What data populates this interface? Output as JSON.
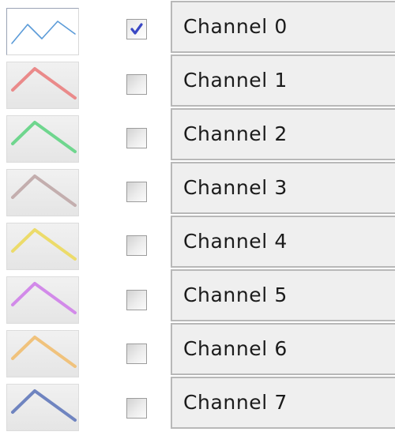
{
  "channels": [
    {
      "label": "Channel 0",
      "checked": true,
      "color": "#5b9bd8",
      "icon": "wave-icon"
    },
    {
      "label": "Channel 1",
      "checked": false,
      "color": "#ea8a8a",
      "icon": "peak-icon"
    },
    {
      "label": "Channel 2",
      "checked": false,
      "color": "#6fd68e",
      "icon": "peak-icon"
    },
    {
      "label": "Channel 3",
      "checked": false,
      "color": "#c3aeae",
      "icon": "peak-icon"
    },
    {
      "label": "Channel 4",
      "checked": false,
      "color": "#ecdb6a",
      "icon": "peak-icon"
    },
    {
      "label": "Channel 5",
      "checked": false,
      "color": "#d28ae9",
      "icon": "peak-icon"
    },
    {
      "label": "Channel 6",
      "checked": false,
      "color": "#f0c27c",
      "icon": "peak-icon"
    },
    {
      "label": "Channel 7",
      "checked": false,
      "color": "#6f84c0",
      "icon": "peak-icon"
    }
  ],
  "check_mark_color": "#3a48c4"
}
